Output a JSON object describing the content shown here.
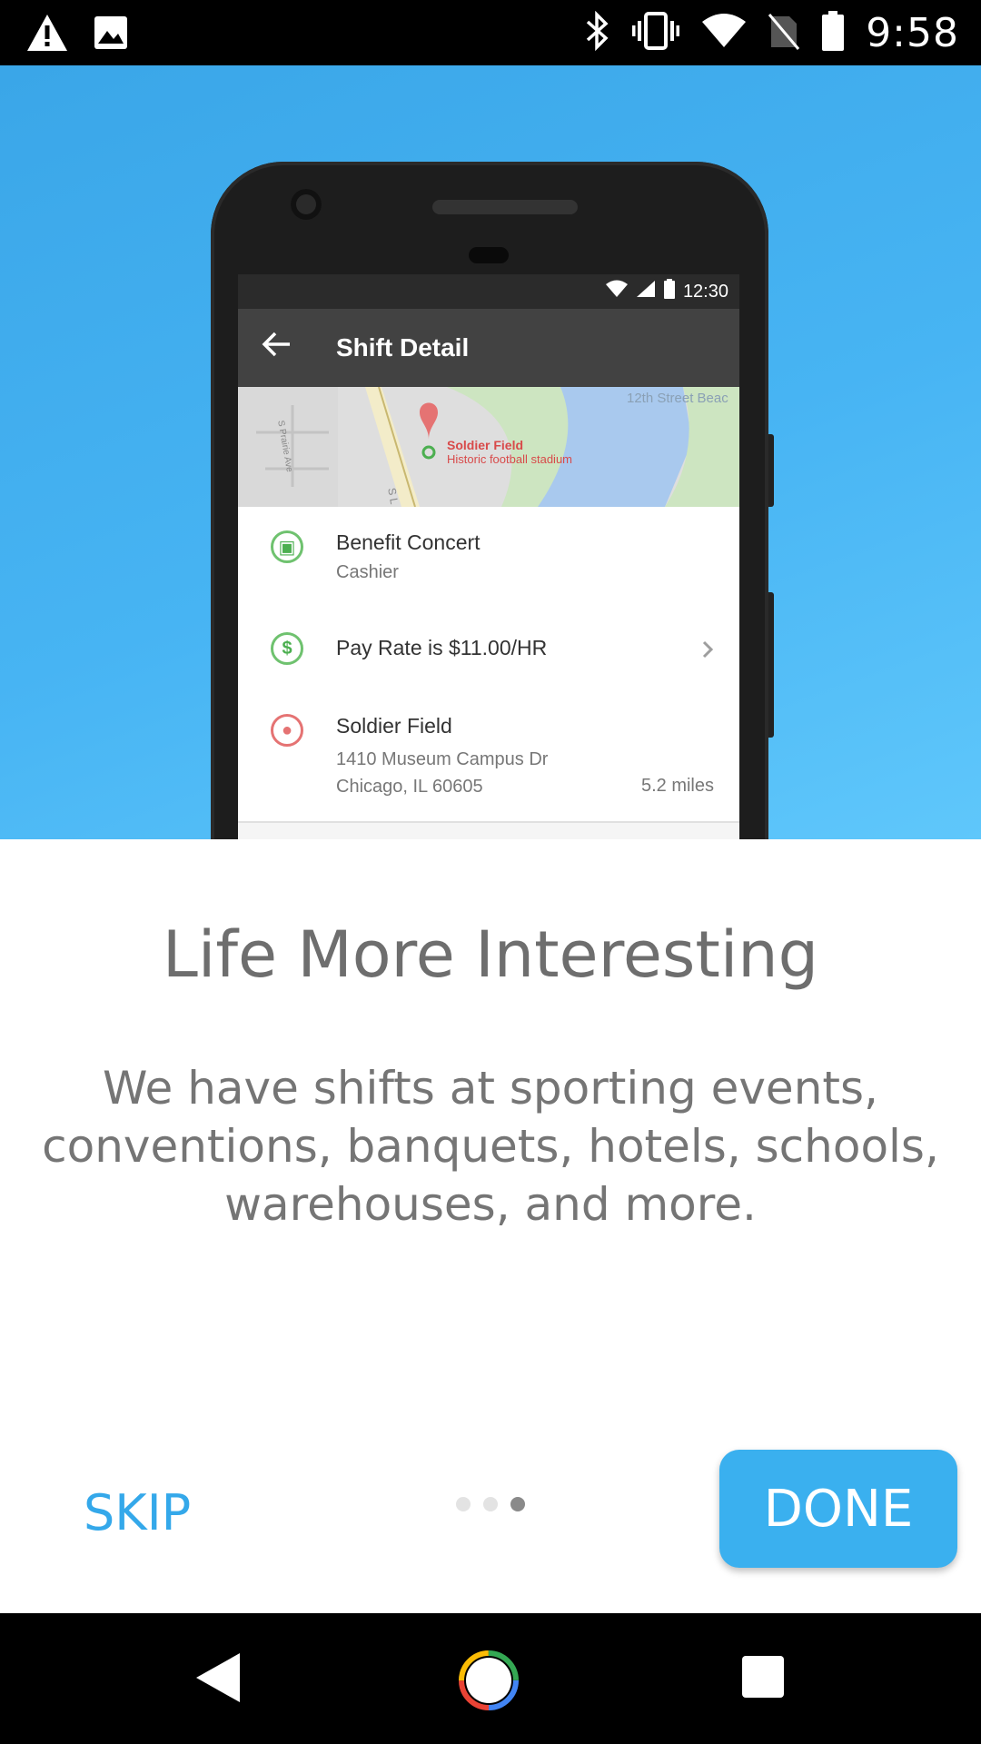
{
  "status_bar": {
    "time": "9:58",
    "left_icons": [
      "warning-icon",
      "image-icon"
    ],
    "right_icons": [
      "bluetooth-icon",
      "vibrate-icon",
      "wifi-icon",
      "no-sim-icon",
      "battery-icon"
    ]
  },
  "phone_screen": {
    "status_time": "12:30",
    "app_bar_title": "Shift Detail",
    "map": {
      "place_name": "Soldier Field",
      "place_desc": "Historic football stadium",
      "beach_label": "12th Street Beac",
      "street_label": "S Prairie Ave",
      "street_label_2": "S L"
    },
    "rows": [
      {
        "icon": "event-icon",
        "title": "Benefit Concert",
        "subtitle": "Cashier"
      },
      {
        "icon": "dollar-icon",
        "title": "Pay Rate is $11.00/HR"
      },
      {
        "icon": "location-pin-icon",
        "title": "Soldier Field",
        "line1": "1410 Museum Campus Dr",
        "line2": "Chicago, IL 60605",
        "distance": "5.2 miles"
      }
    ]
  },
  "onboarding": {
    "title": "Life More Interesting",
    "description": "We have shifts at sporting events, conventions, banquets, hotels, schools, warehouses, and more.",
    "skip_label": "SKIP",
    "done_label": "DONE",
    "page_count": 3,
    "active_page": 3
  },
  "nav_bar": {
    "icons": [
      "back-icon",
      "home-icon",
      "recents-icon"
    ]
  },
  "colors": {
    "accent": "#34a8ea",
    "hero_bg": "#47b4f3",
    "done_bg": "#3ab0ef"
  }
}
